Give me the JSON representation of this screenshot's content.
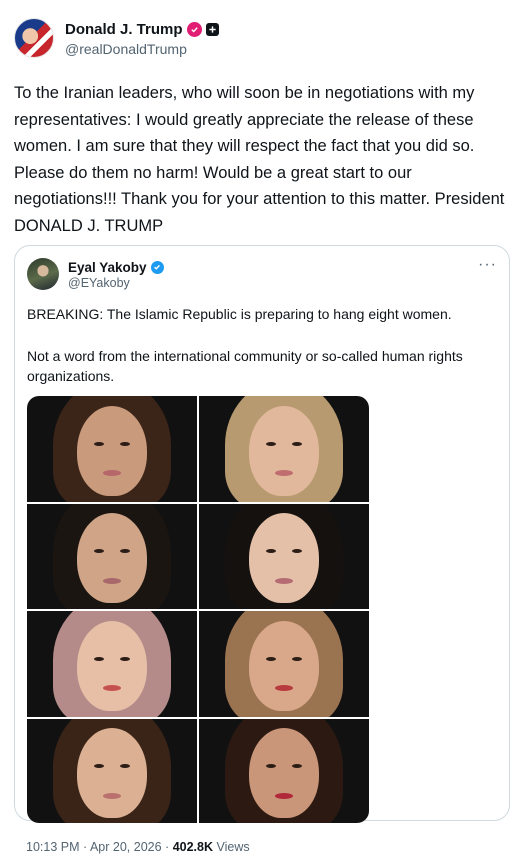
{
  "author": {
    "name": "Donald J. Trump",
    "handle": "@realDonaldTrump",
    "verified_color": "#e11d74"
  },
  "post_text": "To the Iranian leaders, who will soon be in negotiations with my representatives: I would greatly appreciate the release of these women. I am sure that they will respect the fact that you did so. Please do them no harm! Would be a great start to our negotiations!!! Thank you for your attention to this matter. President DONALD J. TRUMP",
  "quote": {
    "name": "Eyal Yakoby",
    "handle": "@EYakoby",
    "more_icon": "···",
    "text_line1": "BREAKING: The Islamic Republic is preparing to hang eight women.",
    "text_line2": "Not a word from the international community or so-called human rights organizations.",
    "verified_color": "#1d9bf0",
    "photos": [
      {
        "hair": "#3b2418",
        "skin": "#c99a7c",
        "lips": "#b5676a"
      },
      {
        "hair": "#b89a70",
        "skin": "#e2b89c",
        "lips": "#c06d6f"
      },
      {
        "hair": "#1b1511",
        "skin": "#cfa487",
        "lips": "#a8676a"
      },
      {
        "hair": "#15110f",
        "skin": "#e4c0a8",
        "lips": "#b46c72"
      },
      {
        "hair": "#b58b89",
        "skin": "#e6bfa6",
        "lips": "#c5514f"
      },
      {
        "hair": "#9a7450",
        "skin": "#d9a88a",
        "lips": "#b83a3c"
      },
      {
        "hair": "#3a2418",
        "skin": "#dcb093",
        "lips": "#b9706e"
      },
      {
        "hair": "#2c1a12",
        "skin": "#c99679",
        "lips": "#b0283a"
      }
    ]
  },
  "footer": {
    "time": "10:13 PM",
    "date": "Apr 20, 2026",
    "views_count": "402.8K",
    "views_label": "Views"
  }
}
